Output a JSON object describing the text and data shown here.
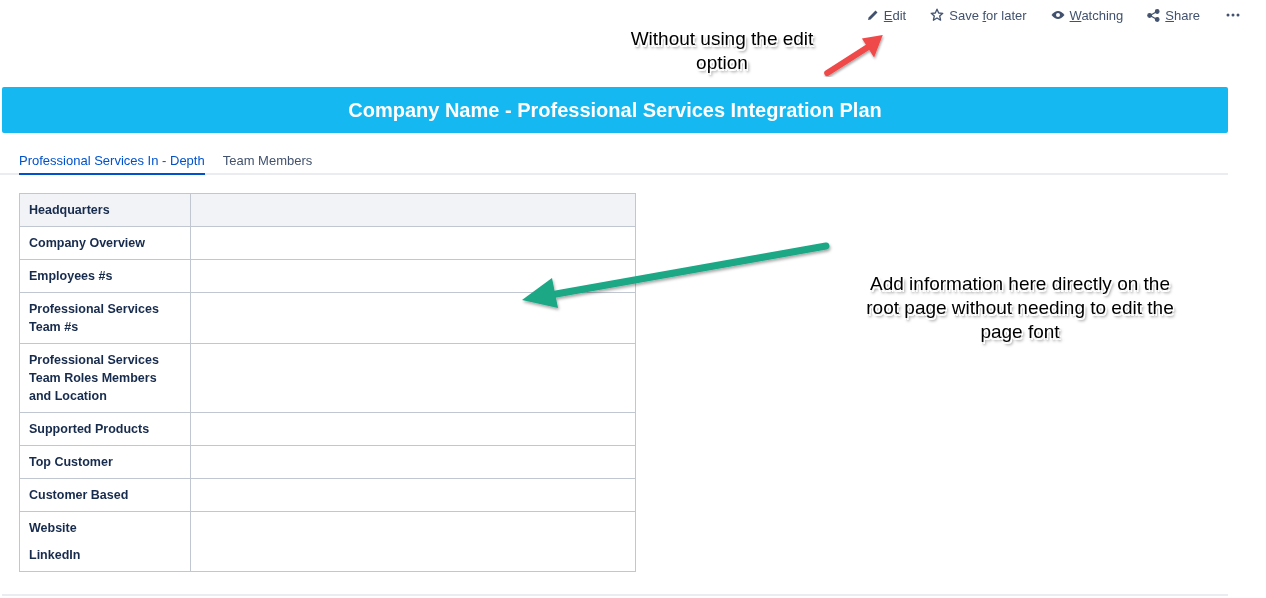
{
  "toolbar": {
    "actions": [
      {
        "kind": "edit",
        "key": "E",
        "after": "dit"
      },
      {
        "kind": "save",
        "before": "Save ",
        "key": "f",
        "after": "or later"
      },
      {
        "kind": "watch",
        "key": "W",
        "after": "atching"
      },
      {
        "kind": "share",
        "key": "S",
        "after": "hare"
      },
      {
        "kind": "more"
      }
    ]
  },
  "annotations": [
    {
      "kind": "top",
      "text": "Without using the edit option"
    },
    {
      "kind": "side",
      "text": "Add information here directly on the root page without needing to edit the page font"
    }
  ],
  "banner": {
    "title": "Company Name - Professional Services Integration Plan"
  },
  "tabs": [
    {
      "label": "Professional Services In - Depth",
      "selected": true
    },
    {
      "label": "Team Members",
      "selected": false
    }
  ],
  "table": {
    "rows": [
      {
        "kind": "header",
        "lines": [
          "Headquarters"
        ]
      },
      {
        "kind": "body",
        "lines": [
          "Company Overview"
        ]
      },
      {
        "kind": "body",
        "lines": [
          "Employees #s"
        ]
      },
      {
        "kind": "body",
        "lines": [
          "Professional Services Team #s"
        ]
      },
      {
        "kind": "body",
        "lines": [
          "Professional Services Team Roles Members and Location"
        ]
      },
      {
        "kind": "body",
        "lines": [
          "Supported Products"
        ]
      },
      {
        "kind": "body",
        "lines": [
          "Top Customer"
        ]
      },
      {
        "kind": "body",
        "lines": [
          "Customer Based"
        ]
      },
      {
        "kind": "body",
        "lines": [
          "Website",
          "LinkedIn"
        ]
      }
    ]
  }
}
